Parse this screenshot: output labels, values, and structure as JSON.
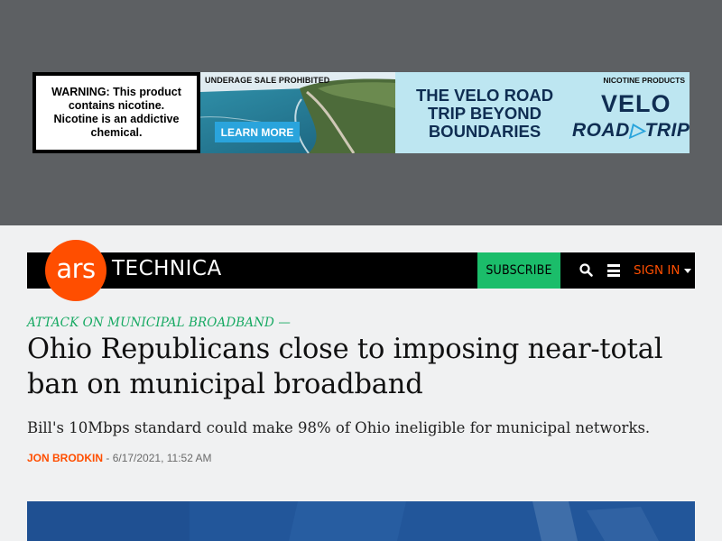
{
  "ad": {
    "warning": "WARNING: This product contains nicotine. Nicotine is an addictive chemical.",
    "underage": "UNDERAGE SALE PROHIBITED",
    "learn_more": "LEARN MORE",
    "nicotine_products": "NICOTINE PRODUCTS",
    "headline": "THE VELO ROAD TRIP BEYOND BOUNDARIES",
    "brand": "VELO",
    "subbrand": "ROAD",
    "subbrand_arrow": "▷",
    "subbrand_end": "TRIP",
    "colors": {
      "band": "#5d6063",
      "panel": "#bde6f1",
      "navy": "#0f2d52",
      "button": "#2aa4dc"
    }
  },
  "nav": {
    "logo_ars": "ars",
    "logo_technica": "TECHNICA",
    "subscribe": "SUBSCRIBE",
    "search_icon": "search-icon",
    "menu_icon": "hamburger-menu-icon",
    "sign_in": "SIGN IN",
    "colors": {
      "brand_orange": "#ff4e00",
      "subscribe_green": "#1bbd6a"
    }
  },
  "article": {
    "kicker": "ATTACK ON MUNICIPAL BROADBAND —",
    "title": "Ohio Republicans close to imposing near-total ban on municipal broadband",
    "dek": "Bill's 10Mbps standard could make 98% of Ohio ineligible for municipal networks.",
    "author": "Jon Brodkin",
    "separator": " - ",
    "date": "6/17/2021, 11:52 AM"
  }
}
